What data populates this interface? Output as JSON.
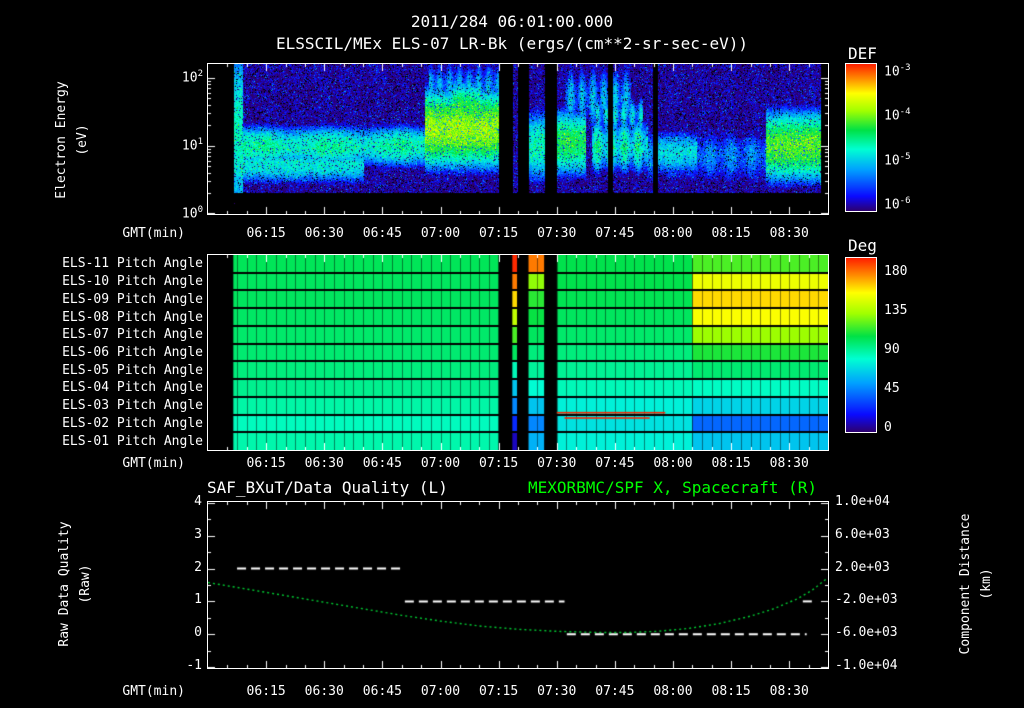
{
  "colors": {
    "bg": "#000000",
    "fg": "#ffffff",
    "accent_green": "#00ff00",
    "curve_green": "#00cc33",
    "red_line": "#ff2200"
  },
  "header": {
    "title": "2011/284 06:01:00.000",
    "subtitle": "ELSSCIL/MEx ELS-07 LR-Bk  (ergs/(cm**2-sr-sec-eV))"
  },
  "x_axis": {
    "label": "GMT(min)",
    "range": [
      0,
      160
    ],
    "minor_step": 5,
    "ticks": [
      {
        "label": "06:15",
        "t": 15
      },
      {
        "label": "06:30",
        "t": 30
      },
      {
        "label": "06:45",
        "t": 45
      },
      {
        "label": "07:00",
        "t": 60
      },
      {
        "label": "07:15",
        "t": 75
      },
      {
        "label": "07:30",
        "t": 90
      },
      {
        "label": "07:45",
        "t": 105
      },
      {
        "label": "08:00",
        "t": 120
      },
      {
        "label": "08:15",
        "t": 135
      },
      {
        "label": "08:30",
        "t": 150
      }
    ]
  },
  "top_panel": {
    "y_label_line1": "Electron Energy",
    "y_label_line2": "(eV)",
    "y_ticks": [
      {
        "base": "10",
        "exp": "2"
      },
      {
        "base": "10",
        "exp": "1"
      },
      {
        "base": "10",
        "exp": "0"
      }
    ],
    "colorbar_title": "DEF",
    "colorbar_ticks": [
      {
        "base": "10",
        "exp": "-3"
      },
      {
        "base": "10",
        "exp": "-4"
      },
      {
        "base": "10",
        "exp": "-5"
      },
      {
        "base": "10",
        "exp": "-6"
      }
    ]
  },
  "middle_panel": {
    "rows": [
      "ELS-11 Pitch Angle",
      "ELS-10 Pitch Angle",
      "ELS-09 Pitch Angle",
      "ELS-08 Pitch Angle",
      "ELS-07 Pitch Angle",
      "ELS-06 Pitch Angle",
      "ELS-05 Pitch Angle",
      "ELS-04 Pitch Angle",
      "ELS-03 Pitch Angle",
      "ELS-02 Pitch Angle",
      "ELS-01 Pitch Angle"
    ],
    "colorbar_title": "Deg",
    "colorbar_ticks": [
      "180",
      "135",
      "90",
      "45",
      "0"
    ]
  },
  "bottom_panel": {
    "title_left": "SAF_BXuT/Data Quality (L)",
    "title_right": "MEXORBMC/SPF X, Spacecraft (R)",
    "y_left_line1": "Raw Data Quality",
    "y_left_line2": "(Raw)",
    "y_left_ticks": [
      "4",
      "3",
      "2",
      "1",
      "0",
      "-1"
    ],
    "y_right_ticks": [
      "1.0e+04",
      "6.0e+03",
      "2.0e+03",
      "-2.0e+03",
      "-6.0e+03",
      "-1.0e+04"
    ],
    "y_right_line1": "Component Distance",
    "y_right_line2": "(km)"
  },
  "chart_data": [
    {
      "type": "heatmap",
      "name": "electron-energy-spectrogram",
      "title": "ELSSCIL/MEx ELS-07 LR-Bk",
      "units": "ergs/(cm**2-sr-sec-eV)",
      "xlabel": "GMT(min)",
      "x_range": [
        "06:00",
        "08:40"
      ],
      "ylabel": "Electron Energy (eV)",
      "y_scale": "log",
      "y_range_ev": [
        1,
        158
      ],
      "z_label": "DEF",
      "z_log10_range": [
        -6,
        -3
      ],
      "log_e_top": 2.2,
      "log_e_span": 2.2,
      "low_cut": 0.32,
      "data_start": 6.5,
      "data_end": 158,
      "data_gaps_min": [
        [
          75,
          78.5
        ],
        [
          79.8,
          82.6
        ],
        [
          86.8,
          90
        ],
        [
          103.2,
          104.3
        ],
        [
          114.6,
          116
        ]
      ],
      "colormap_stops": [
        [
          0,
          [
            45,
            0,
            110
          ]
        ],
        [
          0.1,
          [
            10,
            10,
            255
          ]
        ],
        [
          0.28,
          [
            0,
            160,
            255
          ]
        ],
        [
          0.42,
          [
            0,
            255,
            210
          ]
        ],
        [
          0.55,
          [
            0,
            225,
            70
          ]
        ],
        [
          0.68,
          [
            160,
            255,
            0
          ]
        ],
        [
          0.8,
          [
            255,
            255,
            0
          ]
        ],
        [
          0.9,
          [
            255,
            140,
            0
          ]
        ],
        [
          1,
          [
            255,
            30,
            0
          ]
        ]
      ],
      "features": [
        {
          "t": [
            6.5,
            76
          ],
          "e": 1.0,
          "esig": 0.2,
          "amp": -4.55,
          "mod": [
            0.35,
            0.25
          ]
        },
        {
          "t": [
            6.5,
            40
          ],
          "e": 0.72,
          "esig": 0.18,
          "amp": -4.85
        },
        {
          "t": [
            6.5,
            9
          ],
          "e": 1.2,
          "esig": 0.9,
          "amp": -4.7
        },
        {
          "t": [
            56,
            76
          ],
          "e": 1.25,
          "esig": 0.34,
          "amp": -3.95
        },
        {
          "t": [
            63,
            70
          ],
          "e": 1.55,
          "esig": 0.25,
          "amp": -4.3
        },
        {
          "t": [
            57,
            76
          ],
          "e": 1.85,
          "esig": 0.28,
          "amp": -5.05,
          "mod": [
            2.5,
            0.5
          ]
        },
        {
          "t": [
            82.6,
            86.8
          ],
          "e": 1.0,
          "esig": 0.35,
          "amp": -4.7
        },
        {
          "t": [
            90,
            97.5
          ],
          "e": 1.05,
          "esig": 0.3,
          "amp": -4.35
        },
        {
          "t": [
            92,
            109
          ],
          "e": 1.7,
          "esig": 0.33,
          "amp": -5.0,
          "mod": [
            2.2,
            0.6
          ]
        },
        {
          "t": [
            99,
            113.5
          ],
          "e": 1.0,
          "esig": 0.26,
          "amp": -4.5,
          "mod": [
            1.8,
            0.5
          ]
        },
        {
          "t": [
            100,
            112
          ],
          "e": 1.45,
          "esig": 0.18,
          "amp": -4.8,
          "mod": [
            2.8,
            0.7
          ]
        },
        {
          "t": [
            113.5,
            144
          ],
          "e": 0.85,
          "esig": 0.3,
          "amp": -5.25,
          "mod": [
            1.2,
            0.3
          ]
        },
        {
          "t": [
            115,
            126
          ],
          "e": 0.9,
          "esig": 0.22,
          "amp": -4.9
        },
        {
          "t": [
            144,
            158
          ],
          "e": 1.0,
          "esig": 0.32,
          "amp": -4.15
        }
      ]
    },
    {
      "type": "heatmap",
      "name": "pitch-angle-panel",
      "rows": [
        "ELS-11",
        "ELS-10",
        "ELS-09",
        "ELS-08",
        "ELS-07",
        "ELS-06",
        "ELS-05",
        "ELS-04",
        "ELS-03",
        "ELS-02",
        "ELS-01"
      ],
      "z_label": "Deg",
      "z_range": [
        0,
        180
      ],
      "data_start": 6.5,
      "grid_step_min": 2.5,
      "data_gaps_min": [
        [
          75,
          78.5
        ],
        [
          79.8,
          82.6
        ],
        [
          86.8,
          90
        ]
      ],
      "row_segments": {
        "ELS-11": [
          [
            6.5,
            75,
            96
          ],
          [
            90,
            125,
            98
          ],
          [
            125,
            160,
            110
          ]
        ],
        "ELS-10": [
          [
            6.5,
            75,
            95
          ],
          [
            90,
            125,
            98
          ],
          [
            125,
            160,
            140
          ]
        ],
        "ELS-09": [
          [
            6.5,
            75,
            95
          ],
          [
            90,
            125,
            97
          ],
          [
            125,
            160,
            150
          ]
        ],
        "ELS-08": [
          [
            6.5,
            75,
            94
          ],
          [
            90,
            125,
            95
          ],
          [
            125,
            160,
            143
          ]
        ],
        "ELS-07": [
          [
            6.5,
            75,
            93
          ],
          [
            90,
            125,
            93
          ],
          [
            125,
            160,
            122
          ]
        ],
        "ELS-06": [
          [
            6.5,
            75,
            92
          ],
          [
            90,
            125,
            90
          ],
          [
            125,
            160,
            103
          ]
        ],
        "ELS-05": [
          [
            6.5,
            75,
            90
          ],
          [
            90,
            125,
            86
          ],
          [
            125,
            160,
            92
          ]
        ],
        "ELS-04": [
          [
            6.5,
            75,
            87
          ],
          [
            90,
            125,
            80
          ],
          [
            125,
            160,
            78
          ]
        ],
        "ELS-03": [
          [
            6.5,
            75,
            83
          ],
          [
            90,
            125,
            72
          ],
          [
            125,
            160,
            64
          ]
        ],
        "ELS-02": [
          [
            6.5,
            75,
            79
          ],
          [
            90,
            125,
            68
          ],
          [
            125,
            160,
            38
          ]
        ],
        "ELS-01": [
          [
            6.5,
            75,
            82
          ],
          [
            90,
            125,
            72
          ],
          [
            125,
            160,
            60
          ]
        ]
      },
      "special_columns": [
        {
          "t": [
            78.5,
            79.8
          ],
          "values": [
            178,
            165,
            150,
            130,
            110,
            95,
            80,
            60,
            45,
            25,
            10
          ]
        },
        {
          "t": [
            82.6,
            86.8
          ],
          "values": [
            165,
            120,
            105,
            100,
            95,
            90,
            85,
            75,
            60,
            45,
            55
          ]
        }
      ],
      "red_lines": [
        {
          "row": 8,
          "t": [
            90,
            118
          ],
          "y_frac": 0.85
        },
        {
          "row": 9,
          "t": [
            92,
            114
          ],
          "y_frac": 0.15
        }
      ],
      "red_line_color": "#ff2200"
    },
    {
      "type": "line",
      "name": "quality-and-distance",
      "left_axis": {
        "label": "Raw Data Quality (Raw)",
        "range": [
          -1,
          4
        ]
      },
      "right_axis": {
        "label": "Component Distance (km)",
        "range": [
          -10000,
          10000
        ]
      },
      "series": [
        {
          "name": "SAF_BXuT/Data Quality (L)",
          "axis": "left",
          "color": "#ffffff",
          "dash": [
            9,
            5
          ],
          "width": 2,
          "segments": [
            {
              "y": 2,
              "t": [
                7.5,
                50.5
              ]
            },
            {
              "y": 1,
              "t": [
                50.8,
                92
              ]
            },
            {
              "y": 0,
              "t": [
                92.6,
                154.5
              ]
            },
            {
              "y": 1,
              "t": [
                153.5,
                156.5
              ]
            }
          ]
        },
        {
          "name": "MEXORBMC/SPF X, Spacecraft (R)",
          "axis": "right",
          "color": "#00cc33",
          "dash": [
            2,
            3
          ],
          "width": 1.4,
          "points": [
            [
              0,
              300
            ],
            [
              10,
              -500
            ],
            [
              20,
              -1300
            ],
            [
              30,
              -2100
            ],
            [
              40,
              -2900
            ],
            [
              50,
              -3700
            ],
            [
              60,
              -4400
            ],
            [
              70,
              -5000
            ],
            [
              80,
              -5400
            ],
            [
              90,
              -5650
            ],
            [
              100,
              -5780
            ],
            [
              108,
              -5800
            ],
            [
              116,
              -5650
            ],
            [
              124,
              -5300
            ],
            [
              132,
              -4700
            ],
            [
              140,
              -3800
            ],
            [
              146,
              -2900
            ],
            [
              152,
              -1700
            ],
            [
              156,
              -600
            ],
            [
              160,
              900
            ]
          ]
        }
      ]
    }
  ]
}
